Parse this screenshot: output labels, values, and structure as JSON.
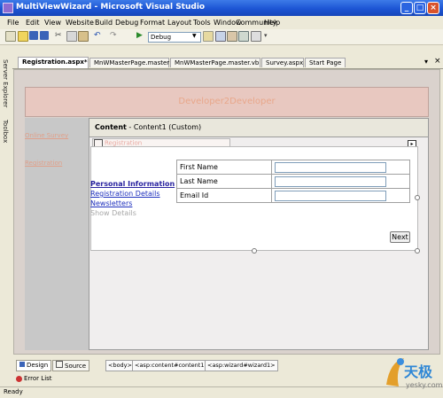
{
  "window": {
    "title": "MultiViewWizard - Microsoft Visual Studio"
  },
  "menu": [
    "File",
    "Edit",
    "View",
    "Website",
    "Build",
    "Debug",
    "Format",
    "Layout",
    "Tools",
    "Window",
    "Community",
    "Help"
  ],
  "toolbar": {
    "configuration": "Debug"
  },
  "side_panels": {
    "server_explorer": "Server Explorer",
    "toolbox": "Toolbox"
  },
  "doc_tabs": [
    "Registration.aspx*",
    "MnWMasterPage.master",
    "MnWMasterPage.master.vb",
    "Survey.aspx",
    "Start Page"
  ],
  "page": {
    "banner": "Developer2Developer",
    "nav_links": [
      "Online Survey",
      "Registration"
    ],
    "content_title": "Content",
    "content_subtitle": " - Content1 (Custom)",
    "wizard_tag": "Registration"
  },
  "wizard": {
    "steps": [
      "Personal Information",
      "Registration Details",
      "Newsletters",
      "Show Details"
    ],
    "fields": [
      {
        "label": "First Name",
        "value": ""
      },
      {
        "label": "Last Name",
        "value": ""
      },
      {
        "label": "Email Id",
        "value": ""
      }
    ],
    "next_label": "Next"
  },
  "bottom": {
    "design_tab": "Design",
    "source_tab": "Source",
    "crumbs": [
      "<body>",
      "<asp:content#content1>",
      "<asp:wizard#wizard1>"
    ],
    "error_list": "Error List",
    "status": "Ready"
  },
  "watermark": {
    "text": "天极",
    "sub": "yesky.com"
  },
  "colors": {
    "titlebar": "#1c55d4",
    "banner": "#e8c8c0",
    "link": "#1d2fbd"
  }
}
